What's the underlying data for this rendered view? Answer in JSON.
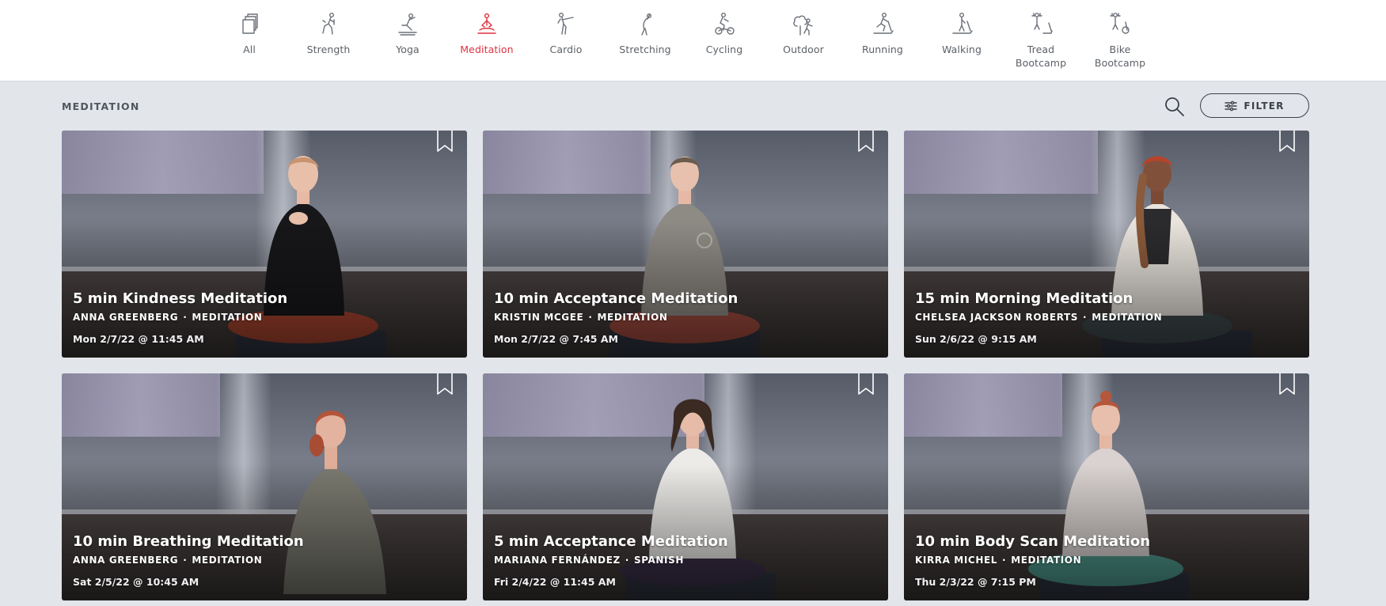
{
  "categories": [
    {
      "label": "All",
      "icon": "all-classes-icon"
    },
    {
      "label": "Strength",
      "icon": "strength-icon"
    },
    {
      "label": "Yoga",
      "icon": "yoga-icon"
    },
    {
      "label": "Meditation",
      "icon": "meditation-icon",
      "active": true
    },
    {
      "label": "Cardio",
      "icon": "cardio-icon"
    },
    {
      "label": "Stretching",
      "icon": "stretching-icon"
    },
    {
      "label": "Cycling",
      "icon": "cycling-icon"
    },
    {
      "label": "Outdoor",
      "icon": "outdoor-icon"
    },
    {
      "label": "Running",
      "icon": "running-icon"
    },
    {
      "label": "Walking",
      "icon": "walking-icon"
    },
    {
      "label": "Tread\nBootcamp",
      "icon": "tread-bootcamp-icon"
    },
    {
      "label": "Bike\nBootcamp",
      "icon": "bike-bootcamp-icon"
    }
  ],
  "section": {
    "title": "MEDITATION",
    "search_icon": "search-icon",
    "filter_label": "FILTER",
    "filter_icon": "sliders-icon"
  },
  "classes": [
    {
      "title": "5 min Kindness Meditation",
      "instructor": "ANNA GREENBERG",
      "discipline": "MEDITATION",
      "date": "Mon 2/7/22 @ 11:45 AM"
    },
    {
      "title": "10 min Acceptance Meditation",
      "instructor": "KRISTIN MCGEE",
      "discipline": "MEDITATION",
      "date": "Mon 2/7/22 @ 7:45 AM"
    },
    {
      "title": "15 min Morning Meditation",
      "instructor": "CHELSEA JACKSON ROBERTS",
      "discipline": "MEDITATION",
      "date": "Sun 2/6/22 @ 9:15 AM"
    },
    {
      "title": "10 min Breathing Meditation",
      "instructor": "ANNA GREENBERG",
      "discipline": "MEDITATION",
      "date": "Sat 2/5/22 @ 10:45 AM"
    },
    {
      "title": "5 min Acceptance Meditation",
      "instructor": "MARIANA FERNÁNDEZ",
      "discipline": "SPANISH",
      "date": "Fri 2/4/22 @ 11:45 AM"
    },
    {
      "title": "10 min Body Scan Meditation",
      "instructor": "KIRRA MICHEL",
      "discipline": "MEDITATION",
      "date": "Thu 2/3/22 @ 7:15 PM"
    }
  ],
  "colors": {
    "accent": "#e0313f",
    "page_bg": "#e2e5ea",
    "topbar_bg": "#ffffff",
    "icon_gray": "#6b7078"
  }
}
